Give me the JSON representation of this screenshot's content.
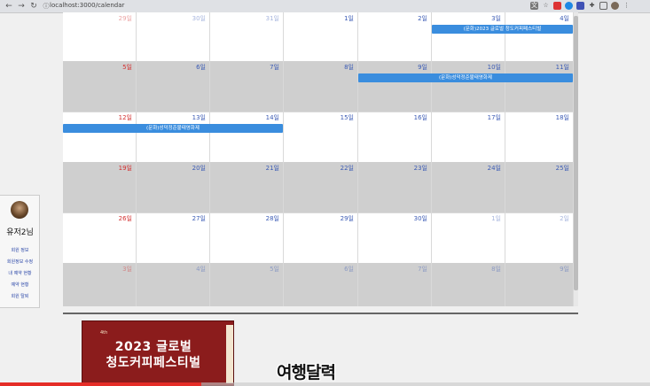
{
  "browser": {
    "url": "localhost:3000/calendar",
    "nav_icons": [
      "back-icon",
      "forward-icon",
      "reload-icon"
    ],
    "extension_icons": [
      "translate-icon",
      "bookmark-star-icon",
      "extension-red-icon",
      "extension-shield-icon",
      "extension-blue-icon",
      "extensions-puzzle-icon",
      "tab-icon",
      "profile-icon",
      "menu-icon"
    ]
  },
  "calendar": {
    "weeks": [
      {
        "gray": false,
        "days": [
          {
            "num": "29일",
            "type": "other-sun"
          },
          {
            "num": "30일",
            "type": "other"
          },
          {
            "num": "31일",
            "type": "other"
          },
          {
            "num": "1일",
            "type": "cur"
          },
          {
            "num": "2일",
            "type": "cur"
          },
          {
            "num": "3일",
            "type": "cur"
          },
          {
            "num": "4일",
            "type": "cur"
          }
        ],
        "events": [
          {
            "title": "(문화)2023 글로벌 청도커피페스티벌",
            "start": 5,
            "span": 2
          }
        ]
      },
      {
        "gray": true,
        "days": [
          {
            "num": "5일",
            "type": "sun"
          },
          {
            "num": "6일",
            "type": "cur"
          },
          {
            "num": "7일",
            "type": "cur"
          },
          {
            "num": "8일",
            "type": "cur"
          },
          {
            "num": "9일",
            "type": "cur"
          },
          {
            "num": "10일",
            "type": "cur"
          },
          {
            "num": "11일",
            "type": "cur"
          }
        ],
        "events": [
          {
            "title": "(문화)성덕정준불태영화제",
            "start": 4,
            "span": 3
          }
        ]
      },
      {
        "gray": false,
        "days": [
          {
            "num": "12일",
            "type": "sun"
          },
          {
            "num": "13일",
            "type": "cur"
          },
          {
            "num": "14일",
            "type": "cur"
          },
          {
            "num": "15일",
            "type": "cur"
          },
          {
            "num": "16일",
            "type": "cur"
          },
          {
            "num": "17일",
            "type": "cur"
          },
          {
            "num": "18일",
            "type": "cur"
          }
        ],
        "events": [
          {
            "title": "(문화)성덕정준불태영화제",
            "start": 0,
            "span": 3
          }
        ]
      },
      {
        "gray": true,
        "days": [
          {
            "num": "19일",
            "type": "sun"
          },
          {
            "num": "20일",
            "type": "cur"
          },
          {
            "num": "21일",
            "type": "cur"
          },
          {
            "num": "22일",
            "type": "cur"
          },
          {
            "num": "23일",
            "type": "cur"
          },
          {
            "num": "24일",
            "type": "cur"
          },
          {
            "num": "25일",
            "type": "cur"
          }
        ],
        "events": []
      },
      {
        "gray": false,
        "days": [
          {
            "num": "26일",
            "type": "sun"
          },
          {
            "num": "27일",
            "type": "cur"
          },
          {
            "num": "28일",
            "type": "cur"
          },
          {
            "num": "29일",
            "type": "cur"
          },
          {
            "num": "30일",
            "type": "cur"
          },
          {
            "num": "1일",
            "type": "other"
          },
          {
            "num": "2일",
            "type": "other"
          }
        ],
        "events": []
      },
      {
        "gray": true,
        "days": [
          {
            "num": "3일",
            "type": "other-sun"
          },
          {
            "num": "4일",
            "type": "other"
          },
          {
            "num": "5일",
            "type": "other"
          },
          {
            "num": "6일",
            "type": "other"
          },
          {
            "num": "7일",
            "type": "other"
          },
          {
            "num": "8일",
            "type": "other"
          },
          {
            "num": "9일",
            "type": "other"
          }
        ],
        "events": []
      }
    ]
  },
  "user": {
    "name": "유저2님",
    "links": [
      "회원 정보",
      "회원정보 수정",
      "내 예약 현황",
      "예약 현황",
      "회원 탈퇴"
    ]
  },
  "poster": {
    "badge": "4th",
    "line1": "2023 글로벌",
    "line2": "청도커피페스티벌"
  },
  "video": {
    "subtitle": "여행달력",
    "progress_percent": 31
  }
}
